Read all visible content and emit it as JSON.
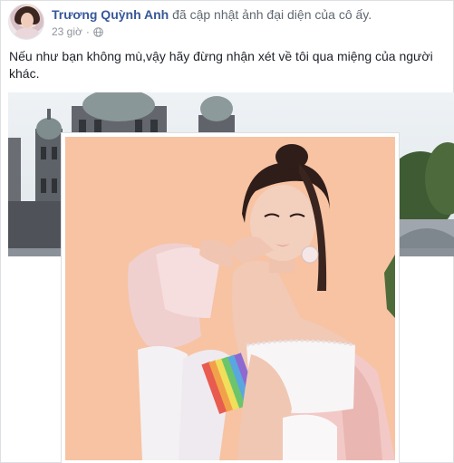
{
  "post": {
    "author": "Trương Quỳnh Anh",
    "action": "đã cập nhật ảnh đại diện của cô ấy.",
    "time": "23 giờ",
    "separator": "·",
    "privacy_icon": "globe-icon",
    "caption_line1": "Nếu như bạn không mù,vậy hãy đừng nhận xét về tôi qua miệng của người",
    "caption_line2": "khác."
  },
  "colors": {
    "author": "#365899",
    "muted": "#90949c",
    "photo_bg": "#f7c3a3"
  }
}
